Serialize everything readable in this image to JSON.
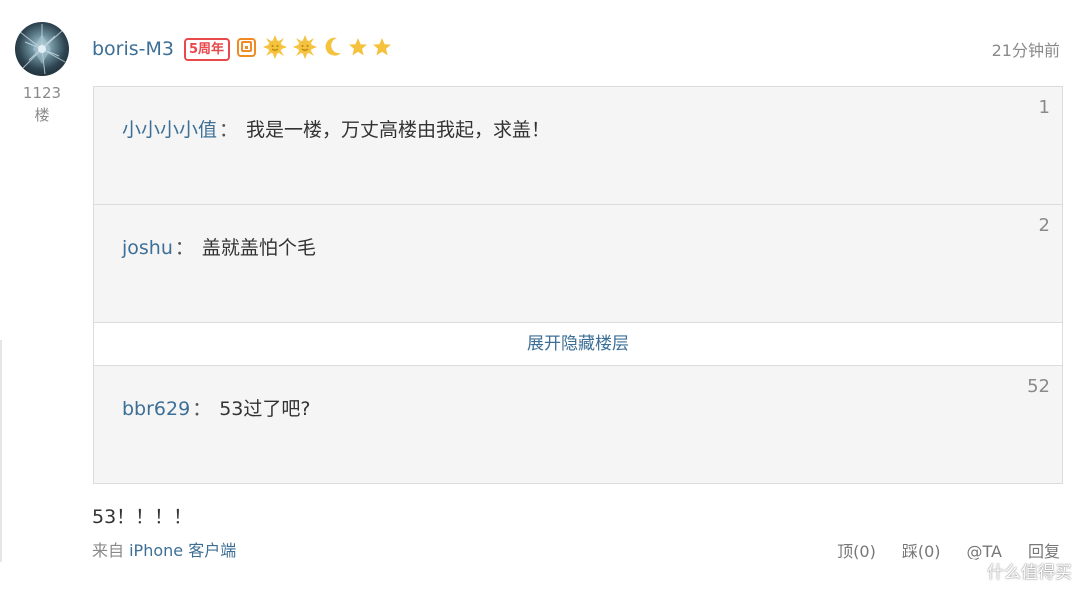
{
  "post": {
    "username": "boris-M3",
    "anniversary_badge": "5周年",
    "timestamp": "21分钟前",
    "floor": {
      "number": "1123",
      "unit": "楼"
    },
    "level_icons": [
      "sun-icon",
      "sun-icon",
      "moon-icon",
      "star-icon",
      "star-icon"
    ],
    "quotes": [
      {
        "author": "小小小小值",
        "separator": "：",
        "text": "我是一楼，万丈高楼由我起，求盖！",
        "floor": "1"
      },
      {
        "author": "joshu",
        "separator": "：",
        "text": "盖就盖怕个毛",
        "floor": "2"
      },
      {
        "author": "bbr629",
        "separator": "：",
        "text": "53过了吧?",
        "floor": "52"
      }
    ],
    "expand_label": "展开隐藏楼层",
    "body": "53！！！！",
    "source": {
      "prefix": "来自",
      "device": "iPhone 客户端"
    },
    "actions": {
      "top": "顶(0)",
      "step": "踩(0)",
      "at": "@TA",
      "reply": "回复"
    }
  },
  "watermark": "什么值得买",
  "colors": {
    "link": "#3d6f96",
    "muted": "#8a8a8a",
    "badge_red": "#e9494b",
    "badge_orange": "#f08a24",
    "level_gold": "#f5c23d",
    "quote_bg": "#f5f5f5",
    "quote_border": "#dcdcdc"
  }
}
